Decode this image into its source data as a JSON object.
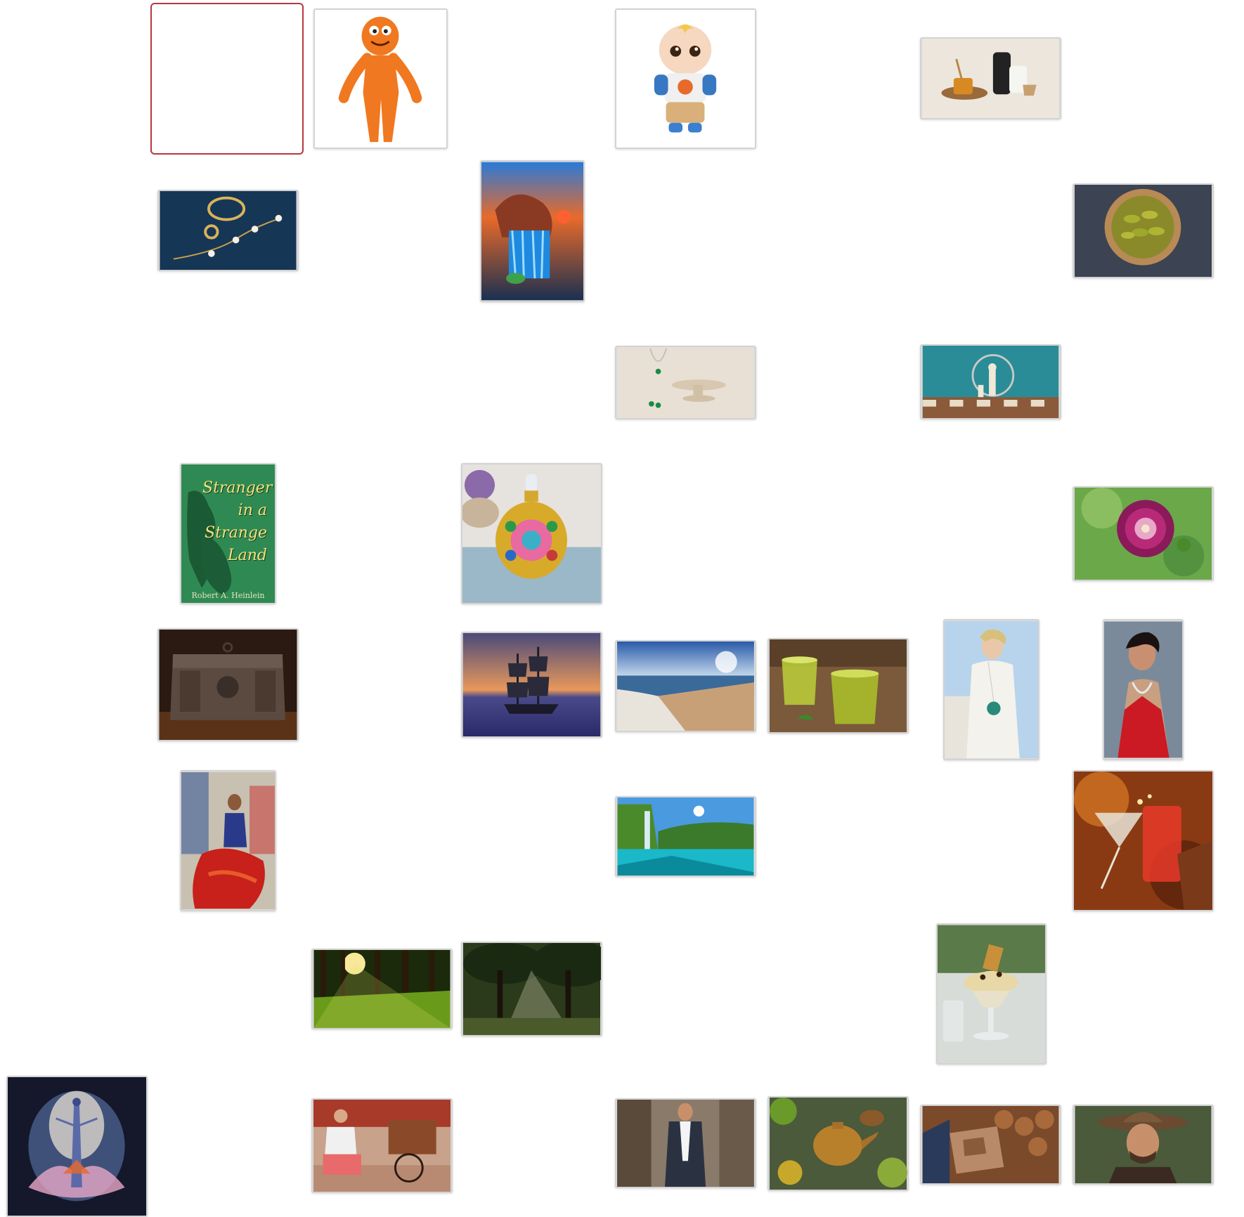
{
  "gallery": {
    "book_cover": {
      "title": "Stranger in a Strange Land",
      "author": "Robert A. Heinlein"
    },
    "tiles": [
      {
        "name": "selected-empty-tile",
        "icon": "empty-slot"
      },
      {
        "name": "orange-plush-figure-tile",
        "icon": "plush-toy"
      },
      {
        "name": "baby-doll-plush-tile",
        "icon": "baby-doll"
      },
      {
        "name": "pottery-tableware-tile",
        "icon": "pottery"
      },
      {
        "name": "gold-bracelets-tile",
        "icon": "jewelry"
      },
      {
        "name": "surreal-waterfall-painting-tile",
        "icon": "painting"
      },
      {
        "name": "pickles-bowl-tile",
        "icon": "food"
      },
      {
        "name": "emerald-jewelry-display-tile",
        "icon": "jewelry"
      },
      {
        "name": "chess-pieces-mirror-tile",
        "icon": "chess"
      },
      {
        "name": "book-cover-tile",
        "icon": "book"
      },
      {
        "name": "perfume-bottle-tile",
        "icon": "perfume"
      },
      {
        "name": "dahlia-flower-tile",
        "icon": "flower"
      },
      {
        "name": "antique-iron-chest-tile",
        "icon": "chest"
      },
      {
        "name": "pirate-ship-sunset-tile",
        "icon": "ship"
      },
      {
        "name": "beach-shoreline-tile",
        "icon": "beach"
      },
      {
        "name": "green-tea-cups-tile",
        "icon": "tea"
      },
      {
        "name": "model-white-outfit-tile",
        "icon": "person"
      },
      {
        "name": "woman-red-dress-tile",
        "icon": "person"
      },
      {
        "name": "flamenco-dancer-painting-tile",
        "icon": "painting"
      },
      {
        "name": "tropical-waterfall-lake-tile",
        "icon": "landscape"
      },
      {
        "name": "cocktail-toast-tile",
        "icon": "drink"
      },
      {
        "name": "forest-sunlight-tile",
        "icon": "forest"
      },
      {
        "name": "misty-trees-sunrays-tile",
        "icon": "forest"
      },
      {
        "name": "ice-cream-sundae-tile",
        "icon": "dessert"
      },
      {
        "name": "watercolor-lotus-woman-tile",
        "icon": "painting"
      },
      {
        "name": "street-vendor-cart-tile",
        "icon": "street"
      },
      {
        "name": "man-suit-street-tile",
        "icon": "person"
      },
      {
        "name": "herbal-teapot-tile",
        "icon": "teapot"
      },
      {
        "name": "firewood-stack-tile",
        "icon": "wood"
      },
      {
        "name": "cowboy-hat-man-tile",
        "icon": "person"
      }
    ]
  }
}
